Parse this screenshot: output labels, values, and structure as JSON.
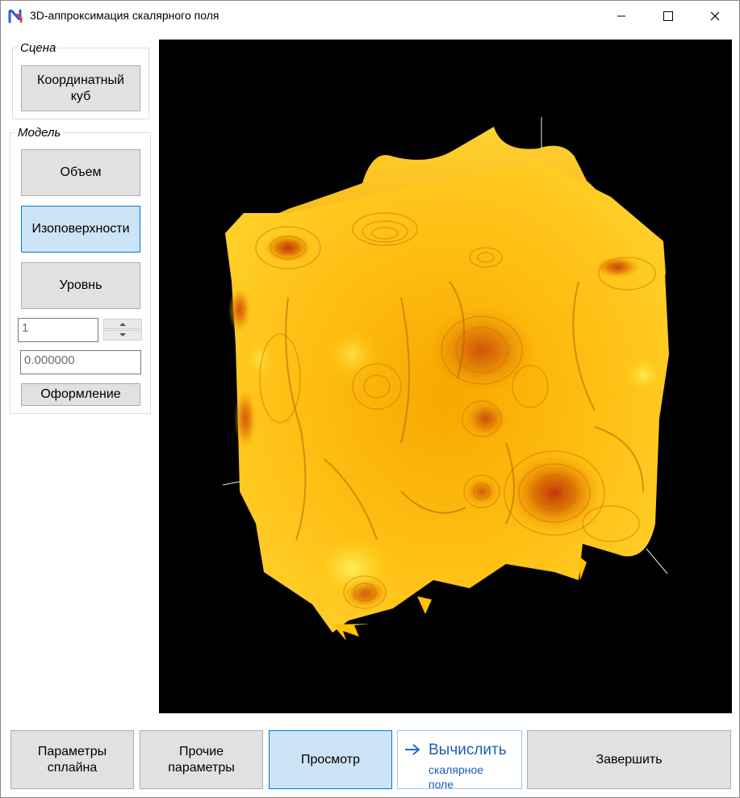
{
  "window": {
    "title": "3D-аппроксимация скалярного поля"
  },
  "scene": {
    "legend": "Сцена",
    "coord_cube_line1": "Координатный",
    "coord_cube_line2": "куб"
  },
  "model": {
    "legend": "Модель",
    "volume_label": "Объем",
    "isosurfaces_label": "Изоповерхности",
    "level_label": "Уровнь",
    "spinner_value": "1",
    "level_value": "0.000000",
    "design_label": "Оформление"
  },
  "bottom": {
    "spline_params_line1": "Параметры",
    "spline_params_line2": "сплайна",
    "other_params_line1": "Прочие",
    "other_params_line2": "параметры",
    "preview_label": "Просмотр",
    "compute_title": "Вычислить",
    "compute_subtitle_line1": "скалярное",
    "compute_subtitle_line2": "поле",
    "finish_label": "Завершить"
  },
  "colors": {
    "accent": "#0078d7",
    "active_button": "#cce4f7",
    "viewport_bg": "#000000",
    "surface_yellow": "#ffc400",
    "surface_orange": "#e98a00",
    "surface_red": "#c2370a"
  },
  "icons": {
    "app": "app-logo-icon",
    "minimize": "minimize-icon",
    "maximize": "maximize-icon",
    "close": "close-icon",
    "arrow": "arrow-right-icon"
  }
}
